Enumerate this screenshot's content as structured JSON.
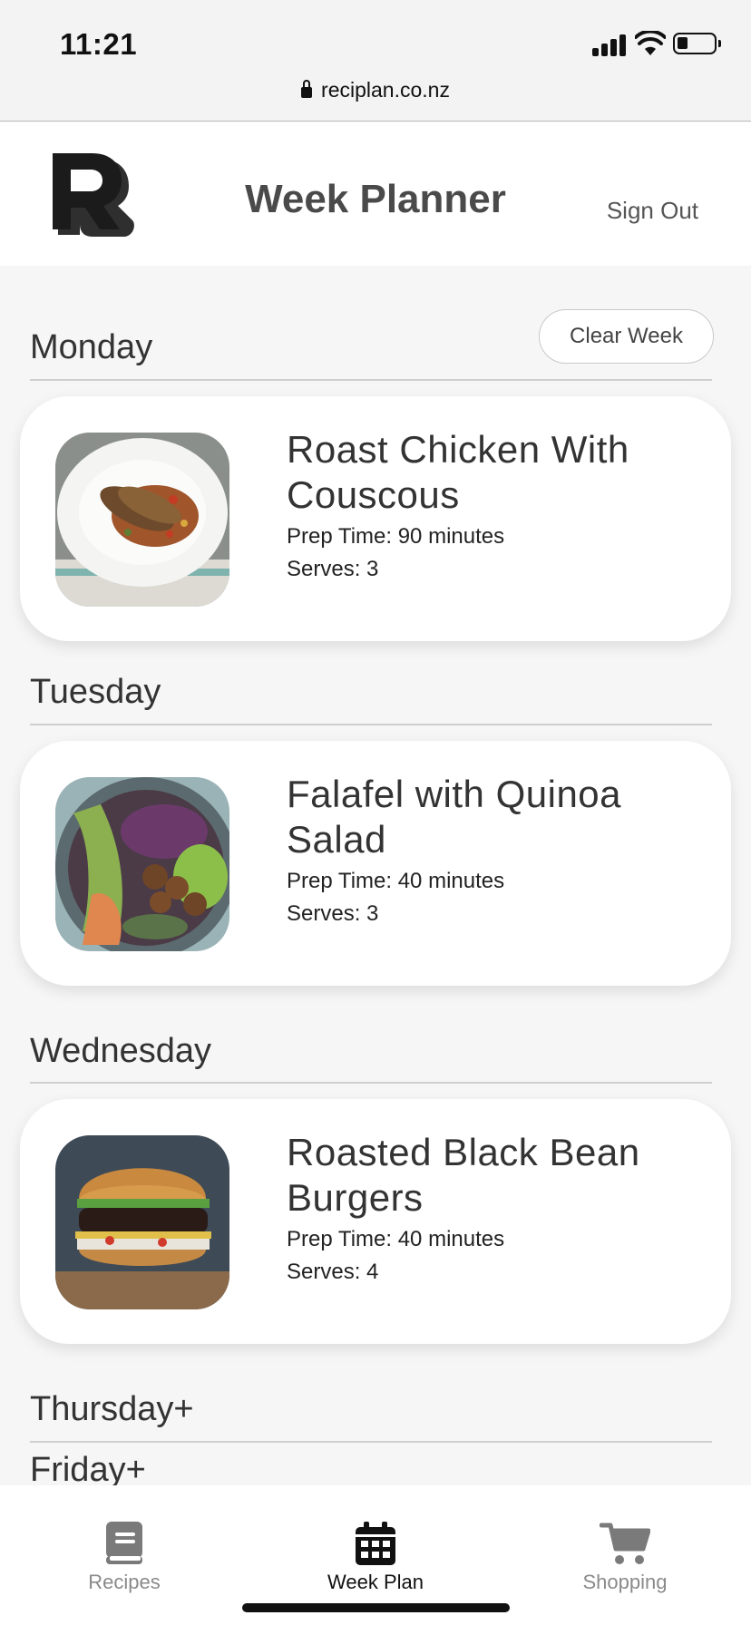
{
  "status_bar": {
    "time": "11:21"
  },
  "browser": {
    "url": "reciplan.co.nz"
  },
  "header": {
    "title": "Week Planner",
    "sign_out_label": "Sign Out"
  },
  "clear_week_label": "Clear Week",
  "days": [
    {
      "label": "Monday",
      "recipe": {
        "title": "Roast Chicken With Couscous",
        "prep_time": "Prep Time: 90 minutes",
        "serves": "Serves: 3"
      }
    },
    {
      "label": "Tuesday",
      "recipe": {
        "title": "Falafel with Quinoa Salad",
        "prep_time": "Prep Time: 40 minutes",
        "serves": "Serves: 3"
      }
    },
    {
      "label": "Wednesday",
      "recipe": {
        "title": "Roasted Black Bean Burgers",
        "prep_time": "Prep Time: 40 minutes",
        "serves": "Serves: 4"
      }
    },
    {
      "label": "Thursday+"
    },
    {
      "label": "Friday+"
    }
  ],
  "bottom_nav": [
    {
      "label": "Recipes",
      "icon": "book-icon",
      "active": false
    },
    {
      "label": "Week Plan",
      "icon": "calendar-icon",
      "active": true
    },
    {
      "label": "Shopping",
      "icon": "cart-icon",
      "active": false
    }
  ],
  "colors": {
    "background": "#f6f6f6",
    "card": "#ffffff",
    "active_nav": "#111111",
    "inactive_nav": "#8a8a8a"
  }
}
